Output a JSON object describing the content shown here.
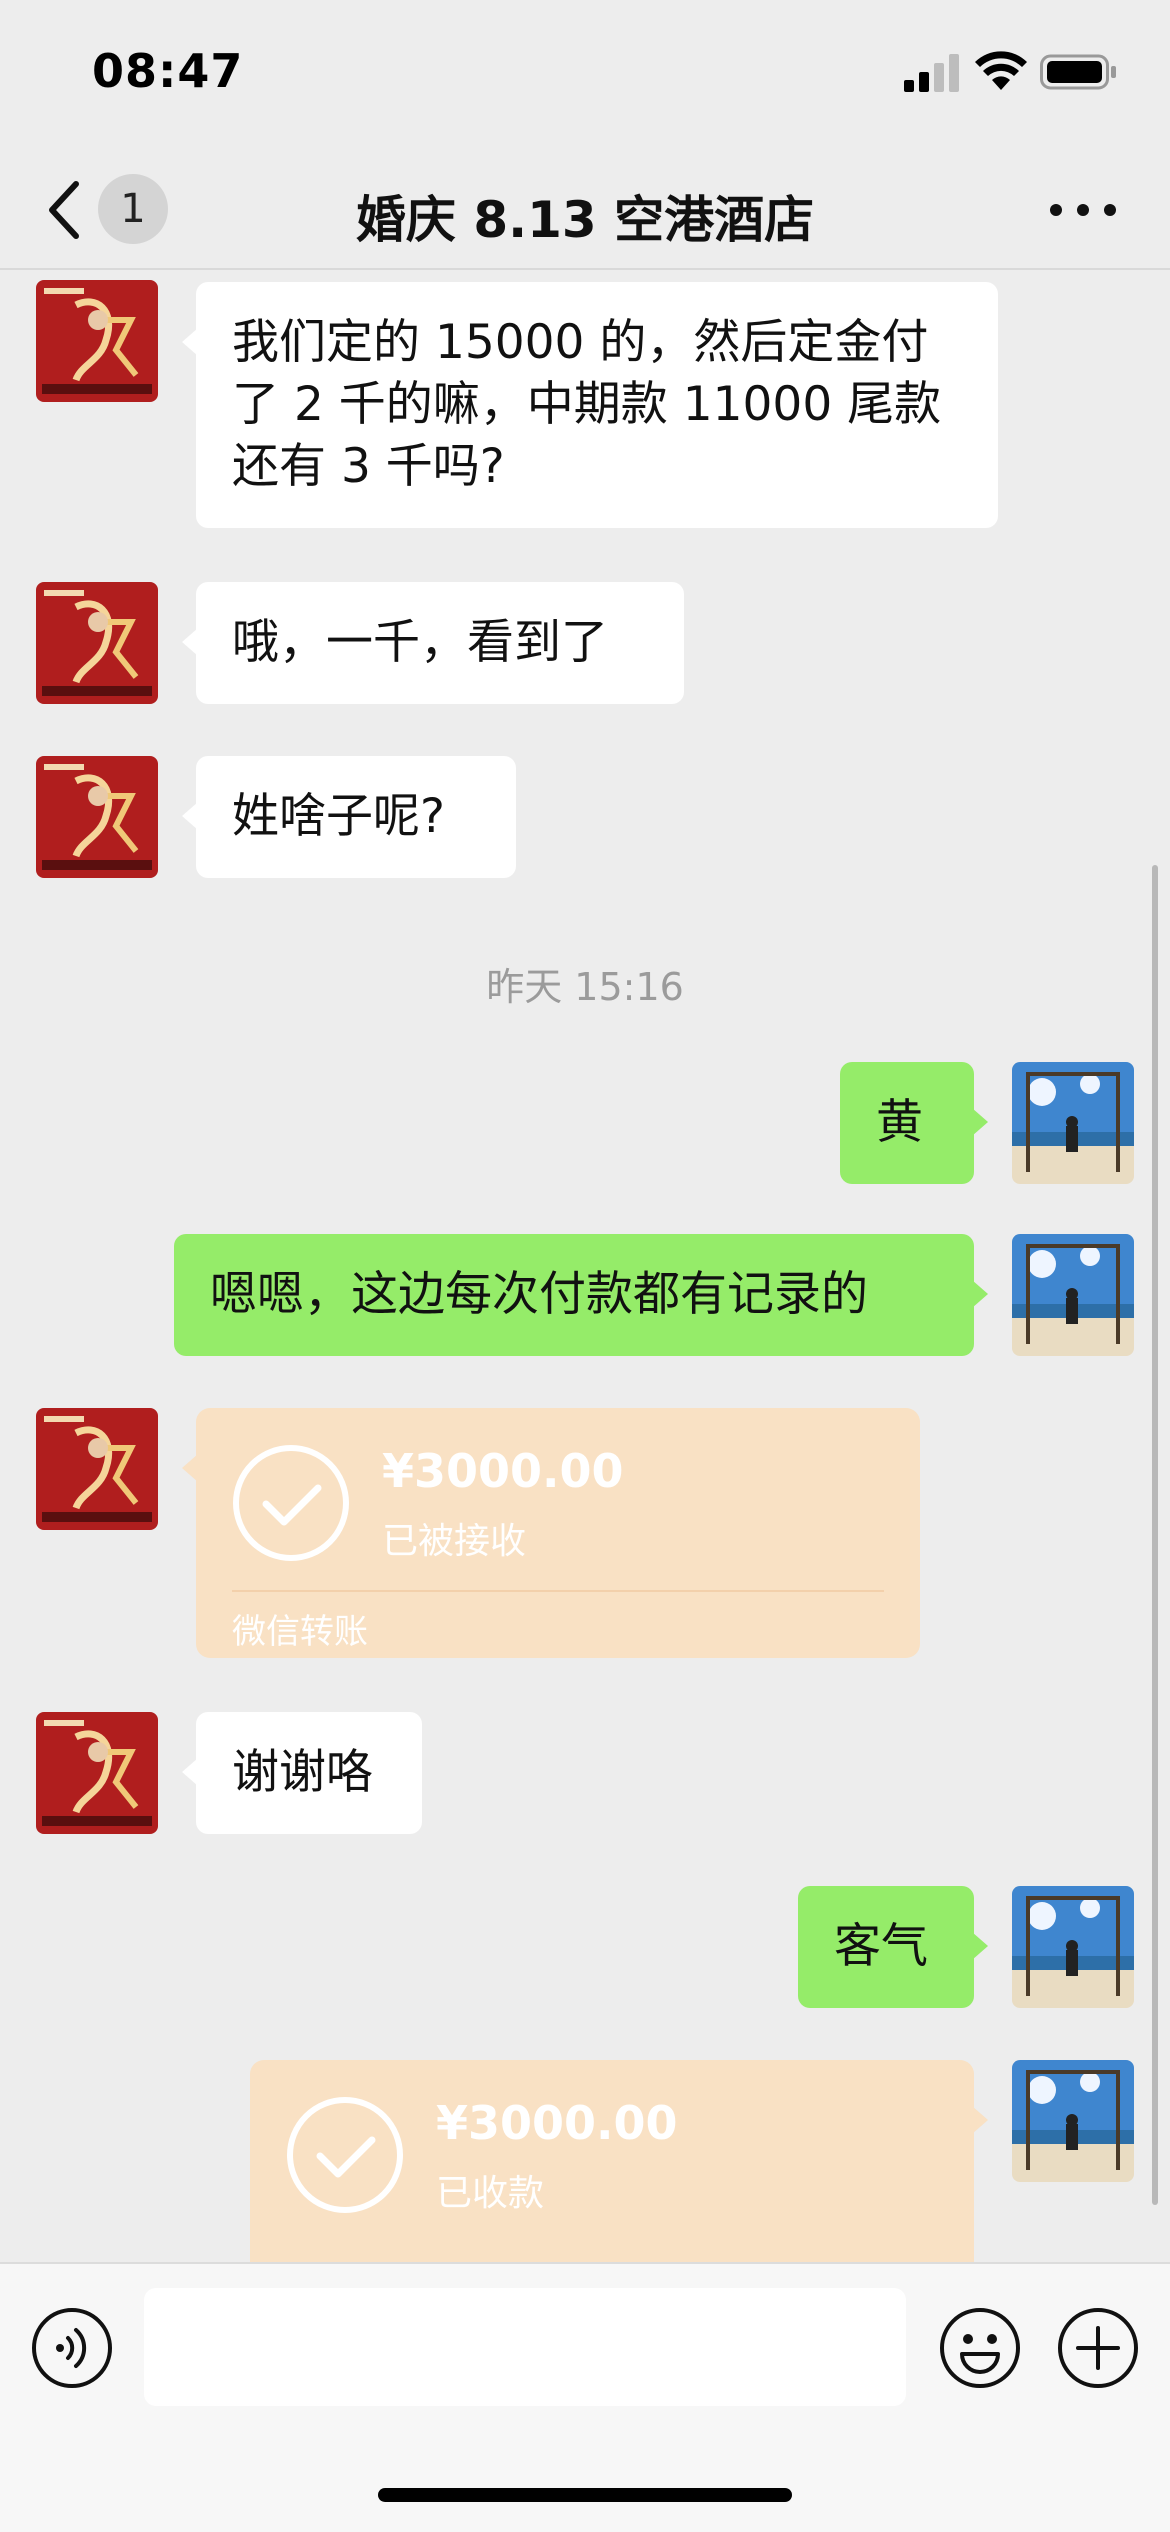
{
  "status_bar": {
    "time": "08:47",
    "icons": [
      "signal-icon",
      "wifi-icon",
      "battery-icon"
    ]
  },
  "nav": {
    "unread_count": "1",
    "title": "婚庆 8.13 空港酒店",
    "icons": [
      "back-chevron-icon",
      "more-icon"
    ]
  },
  "messages": {
    "m1": {
      "sender": "other",
      "text_lines": [
        "我们定的 15000 的，然后定金付",
        "了 2 千的嘛，中期款 11000 尾款",
        "还有 3 千吗?"
      ]
    },
    "m2": {
      "sender": "other",
      "text": "哦，一千，看到了"
    },
    "m3": {
      "sender": "other",
      "text": "姓啥子呢?"
    },
    "time_divider": "昨天 15:16",
    "m4": {
      "sender": "me",
      "text": "黄"
    },
    "m5": {
      "sender": "me",
      "text": "嗯嗯，这边每次付款都有记录的"
    },
    "m6": {
      "sender": "other",
      "type": "transfer",
      "amount": "¥3000.00",
      "status": "已被接收",
      "source": "微信转账"
    },
    "m7": {
      "sender": "other",
      "text": "谢谢咯"
    },
    "m8": {
      "sender": "me",
      "text": "客气"
    },
    "m9": {
      "sender": "me",
      "type": "transfer",
      "amount": "¥3000.00",
      "status": "已收款"
    }
  },
  "input": {
    "placeholder": ""
  },
  "colors": {
    "background": "#ededed",
    "incoming_bubble": "#ffffff",
    "outgoing_bubble": "#95ec69",
    "transfer_card": "#f9e1c4",
    "timestamp": "#9b9b9b"
  }
}
